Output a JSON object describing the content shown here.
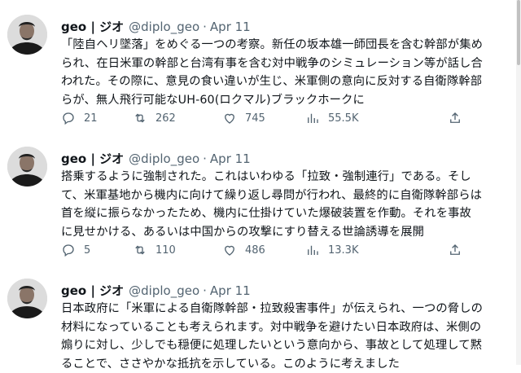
{
  "tweets": [
    {
      "name": "geo | ジオ",
      "handle": "@diplo_geo",
      "separator": "·",
      "date": "Apr 11",
      "lines": [
        "「陸自ヘリ墜落」をめぐる一つの考察。新任の坂本雄一師団長を含む幹部が集め",
        "られ、在日米軍の幹部と台湾有事を含む対中戦争のシミュレーション等が話し合",
        "われた。その際に、意見の食い違いが生じ、米軍側の意向に反対する自衛隊幹部",
        "らが、無人飛行可能なUH-60(ロクマル)ブラックホークに"
      ],
      "stats": {
        "replies": "21",
        "retweets": "262",
        "likes": "745",
        "views": "55.5K"
      }
    },
    {
      "name": "geo | ジオ",
      "handle": "@diplo_geo",
      "separator": "·",
      "date": "Apr 11",
      "lines": [
        "搭乗するように強制された。これはいわゆる「拉致・強制連行」である。そし",
        "て、米軍基地から機内に向けて繰り返し尋問が行われ、最終的に自衛隊幹部らは",
        "首を縦に振らなかったため、機内に仕掛けていた爆破装置を作動。それを事故",
        "に見せかける、あるいは中国からの攻撃にすり替える世論誘導を展開"
      ],
      "stats": {
        "replies": "5",
        "retweets": "110",
        "likes": "486",
        "views": "13.3K"
      }
    },
    {
      "name": "geo | ジオ",
      "handle": "@diplo_geo",
      "separator": "·",
      "date": "Apr 11",
      "lines": [
        "日本政府に「米軍による自衛隊幹部・拉致殺害事件」が伝えられ、一つの脅しの",
        "材料になっていることも考えられます。対中戦争を避けたい日本政府は、米側の",
        "煽りに対し、少しでも穏便に処理したいという意向から、事故として処理して黙",
        "ることで、ささやかな抵抗を示している。このように考えました"
      ]
    }
  ],
  "colors": {
    "text": "#0f1419",
    "muted": "#536471",
    "background": "#ffffff"
  },
  "icons": [
    "reply-icon",
    "retweet-icon",
    "like-icon",
    "views-icon",
    "share-icon"
  ]
}
